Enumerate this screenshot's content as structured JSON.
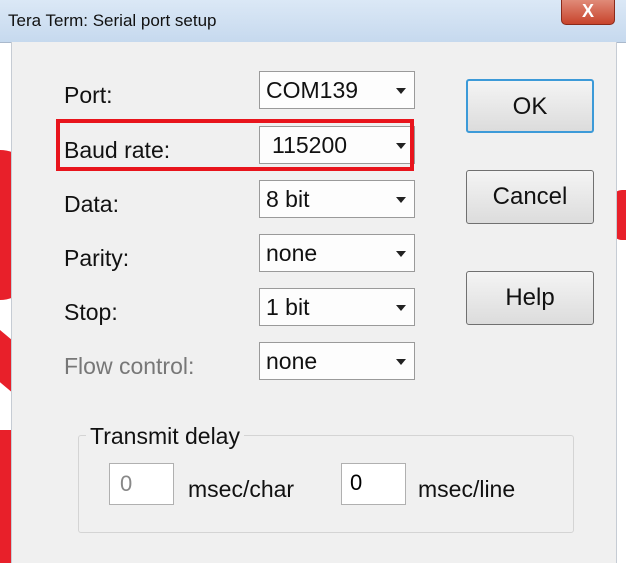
{
  "window": {
    "title": "Tera Term: Serial port setup",
    "close_glyph": "X"
  },
  "form": {
    "port": {
      "label": "Port:",
      "value": "COM139"
    },
    "baud_rate": {
      "label": "Baud rate:",
      "value": "115200"
    },
    "data": {
      "label": "Data:",
      "value": "8 bit"
    },
    "parity": {
      "label": "Parity:",
      "value": "none"
    },
    "stop": {
      "label": "Stop:",
      "value": "1 bit"
    },
    "flow_control": {
      "label": "Flow control:",
      "value": "none"
    }
  },
  "buttons": {
    "ok": "OK",
    "cancel": "Cancel",
    "help": "Help"
  },
  "transmit_delay": {
    "label": "Transmit delay",
    "char_value": "0",
    "char_unit": "msec/char",
    "line_value": "0",
    "line_unit": "msec/line"
  },
  "colors": {
    "highlight": "#e8141c",
    "default_button_border": "#3c9ad8",
    "dialog_background": "#f0f0f0"
  }
}
